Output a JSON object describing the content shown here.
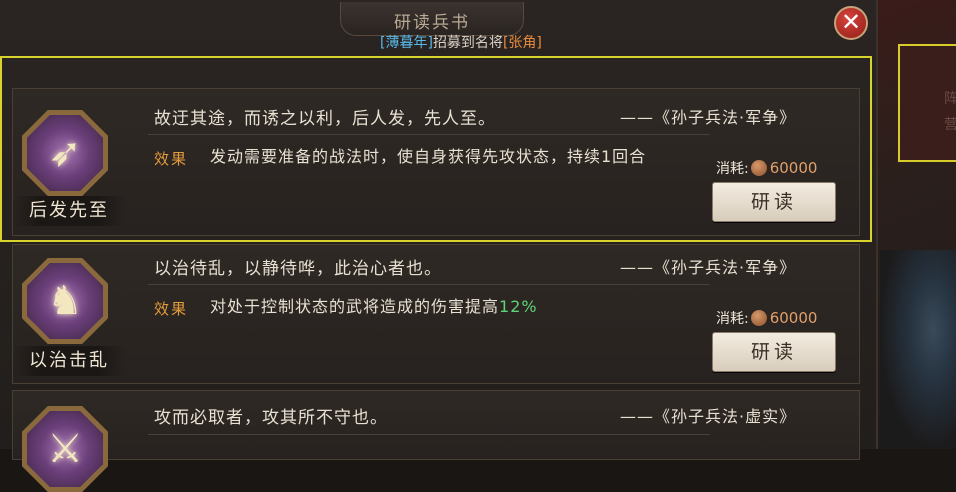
{
  "header": {
    "title": "研读兵书",
    "subtitle_prefix": "[薄暮年]",
    "subtitle_middle": "招募到名将",
    "subtitle_suffix": "[张角]",
    "close_label": "✕"
  },
  "effect_label": "效果",
  "cost_label": "消耗:",
  "study_label": "研读",
  "cards": [
    {
      "name": "后发先至",
      "quote": "故迂其途，而诱之以利，后人发，先人至。",
      "source": "——《孙子兵法·军争》",
      "effect": "发动需要准备的战法时，使自身获得先攻状态，持续1回合",
      "cost": "60000",
      "icon": "arrow-swirl-icon"
    },
    {
      "name": "以治击乱",
      "quote": "以治待乱，以静待哗，此治心者也。",
      "source": "——《孙子兵法·军争》",
      "effect_prefix": "对处于控制状态的武将造成的伤害提高",
      "effect_value": "12%",
      "cost": "60000",
      "icon": "sage-figure-icon"
    },
    {
      "name": "",
      "quote": "攻而必取者，攻其所不守也。",
      "source": "——《孙子兵法·虚实》",
      "icon": "sword-icon"
    }
  ],
  "right_panel": {
    "text": "阵营"
  }
}
